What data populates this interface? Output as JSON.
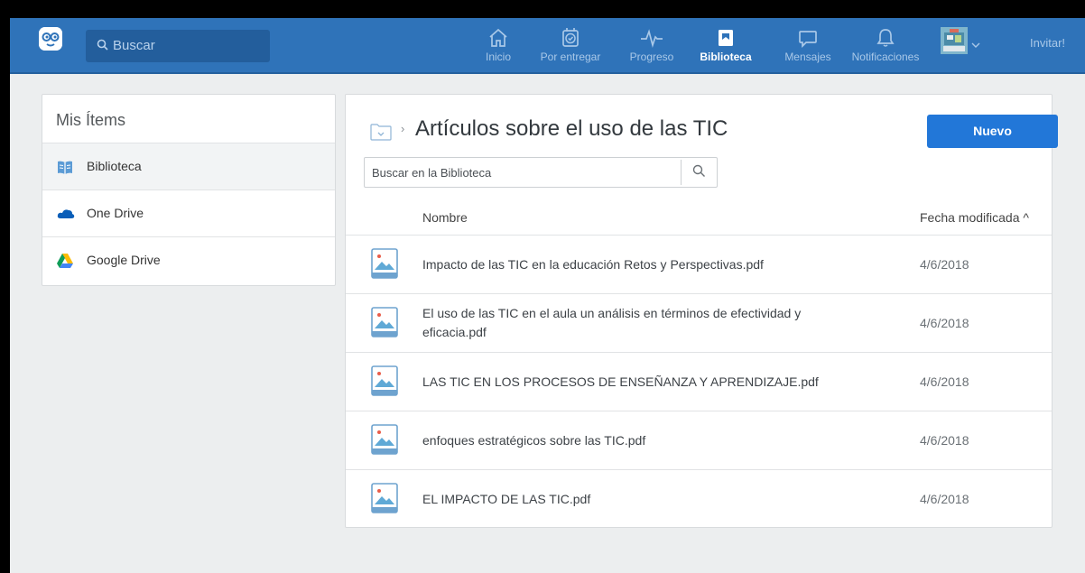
{
  "header": {
    "search_placeholder": "Buscar",
    "nav": [
      {
        "label": "Inicio",
        "icon": "home-icon"
      },
      {
        "label": "Por entregar",
        "icon": "clock-check-icon"
      },
      {
        "label": "Progreso",
        "icon": "pulse-icon"
      },
      {
        "label": "Biblioteca",
        "icon": "bookmark-icon",
        "active": true
      },
      {
        "label": "Mensajes",
        "icon": "chat-bubble-icon"
      },
      {
        "label": "Notificaciones",
        "icon": "bell-icon"
      }
    ],
    "invite_label": "Invitar!"
  },
  "sidebar": {
    "title": "Mis Ítems",
    "items": [
      {
        "label": "Biblioteca",
        "icon": "book-icon",
        "active": true
      },
      {
        "label": "One Drive",
        "icon": "onedrive-icon"
      },
      {
        "label": "Google Drive",
        "icon": "google-drive-icon"
      }
    ]
  },
  "main": {
    "title": "Artículos sobre el uso de las TIC",
    "new_button": "Nuevo",
    "search_placeholder": "Buscar en la Biblioteca",
    "columns": {
      "name": "Nombre",
      "date": "Fecha modificada ^"
    },
    "files": [
      {
        "name": "Impacto de las TIC en la educación Retos y Perspectivas.pdf",
        "date": "4/6/2018"
      },
      {
        "name": "El uso de las TIC en el aula un análisis en términos de efectividad y eficacia.pdf",
        "date": "4/6/2018"
      },
      {
        "name": "LAS TIC EN LOS PROCESOS DE ENSEÑANZA Y APRENDIZAJE.pdf",
        "date": "4/6/2018"
      },
      {
        "name": "enfoques estratégicos sobre las TIC.pdf",
        "date": "4/6/2018"
      },
      {
        "name": "EL IMPACTO DE LAS TIC.pdf",
        "date": "4/6/2018"
      }
    ]
  },
  "colors": {
    "nav_bg": "#2f73b9",
    "accent_button": "#2277d8",
    "page_bg": "#eceeef"
  }
}
